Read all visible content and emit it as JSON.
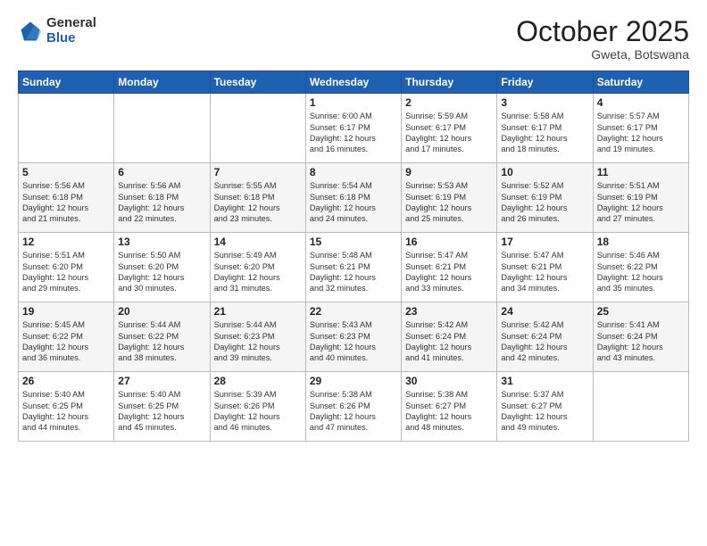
{
  "header": {
    "logo_general": "General",
    "logo_blue": "Blue",
    "month_title": "October 2025",
    "subtitle": "Gweta, Botswana"
  },
  "days_of_week": [
    "Sunday",
    "Monday",
    "Tuesday",
    "Wednesday",
    "Thursday",
    "Friday",
    "Saturday"
  ],
  "weeks": [
    [
      {
        "day": "",
        "info": ""
      },
      {
        "day": "",
        "info": ""
      },
      {
        "day": "",
        "info": ""
      },
      {
        "day": "1",
        "info": "Sunrise: 6:00 AM\nSunset: 6:17 PM\nDaylight: 12 hours\nand 16 minutes."
      },
      {
        "day": "2",
        "info": "Sunrise: 5:59 AM\nSunset: 6:17 PM\nDaylight: 12 hours\nand 17 minutes."
      },
      {
        "day": "3",
        "info": "Sunrise: 5:58 AM\nSunset: 6:17 PM\nDaylight: 12 hours\nand 18 minutes."
      },
      {
        "day": "4",
        "info": "Sunrise: 5:57 AM\nSunset: 6:17 PM\nDaylight: 12 hours\nand 19 minutes."
      }
    ],
    [
      {
        "day": "5",
        "info": "Sunrise: 5:56 AM\nSunset: 6:18 PM\nDaylight: 12 hours\nand 21 minutes."
      },
      {
        "day": "6",
        "info": "Sunrise: 5:56 AM\nSunset: 6:18 PM\nDaylight: 12 hours\nand 22 minutes."
      },
      {
        "day": "7",
        "info": "Sunrise: 5:55 AM\nSunset: 6:18 PM\nDaylight: 12 hours\nand 23 minutes."
      },
      {
        "day": "8",
        "info": "Sunrise: 5:54 AM\nSunset: 6:18 PM\nDaylight: 12 hours\nand 24 minutes."
      },
      {
        "day": "9",
        "info": "Sunrise: 5:53 AM\nSunset: 6:19 PM\nDaylight: 12 hours\nand 25 minutes."
      },
      {
        "day": "10",
        "info": "Sunrise: 5:52 AM\nSunset: 6:19 PM\nDaylight: 12 hours\nand 26 minutes."
      },
      {
        "day": "11",
        "info": "Sunrise: 5:51 AM\nSunset: 6:19 PM\nDaylight: 12 hours\nand 27 minutes."
      }
    ],
    [
      {
        "day": "12",
        "info": "Sunrise: 5:51 AM\nSunset: 6:20 PM\nDaylight: 12 hours\nand 29 minutes."
      },
      {
        "day": "13",
        "info": "Sunrise: 5:50 AM\nSunset: 6:20 PM\nDaylight: 12 hours\nand 30 minutes."
      },
      {
        "day": "14",
        "info": "Sunrise: 5:49 AM\nSunset: 6:20 PM\nDaylight: 12 hours\nand 31 minutes."
      },
      {
        "day": "15",
        "info": "Sunrise: 5:48 AM\nSunset: 6:21 PM\nDaylight: 12 hours\nand 32 minutes."
      },
      {
        "day": "16",
        "info": "Sunrise: 5:47 AM\nSunset: 6:21 PM\nDaylight: 12 hours\nand 33 minutes."
      },
      {
        "day": "17",
        "info": "Sunrise: 5:47 AM\nSunset: 6:21 PM\nDaylight: 12 hours\nand 34 minutes."
      },
      {
        "day": "18",
        "info": "Sunrise: 5:46 AM\nSunset: 6:22 PM\nDaylight: 12 hours\nand 35 minutes."
      }
    ],
    [
      {
        "day": "19",
        "info": "Sunrise: 5:45 AM\nSunset: 6:22 PM\nDaylight: 12 hours\nand 36 minutes."
      },
      {
        "day": "20",
        "info": "Sunrise: 5:44 AM\nSunset: 6:22 PM\nDaylight: 12 hours\nand 38 minutes."
      },
      {
        "day": "21",
        "info": "Sunrise: 5:44 AM\nSunset: 6:23 PM\nDaylight: 12 hours\nand 39 minutes."
      },
      {
        "day": "22",
        "info": "Sunrise: 5:43 AM\nSunset: 6:23 PM\nDaylight: 12 hours\nand 40 minutes."
      },
      {
        "day": "23",
        "info": "Sunrise: 5:42 AM\nSunset: 6:24 PM\nDaylight: 12 hours\nand 41 minutes."
      },
      {
        "day": "24",
        "info": "Sunrise: 5:42 AM\nSunset: 6:24 PM\nDaylight: 12 hours\nand 42 minutes."
      },
      {
        "day": "25",
        "info": "Sunrise: 5:41 AM\nSunset: 6:24 PM\nDaylight: 12 hours\nand 43 minutes."
      }
    ],
    [
      {
        "day": "26",
        "info": "Sunrise: 5:40 AM\nSunset: 6:25 PM\nDaylight: 12 hours\nand 44 minutes."
      },
      {
        "day": "27",
        "info": "Sunrise: 5:40 AM\nSunset: 6:25 PM\nDaylight: 12 hours\nand 45 minutes."
      },
      {
        "day": "28",
        "info": "Sunrise: 5:39 AM\nSunset: 6:26 PM\nDaylight: 12 hours\nand 46 minutes."
      },
      {
        "day": "29",
        "info": "Sunrise: 5:38 AM\nSunset: 6:26 PM\nDaylight: 12 hours\nand 47 minutes."
      },
      {
        "day": "30",
        "info": "Sunrise: 5:38 AM\nSunset: 6:27 PM\nDaylight: 12 hours\nand 48 minutes."
      },
      {
        "day": "31",
        "info": "Sunrise: 5:37 AM\nSunset: 6:27 PM\nDaylight: 12 hours\nand 49 minutes."
      },
      {
        "day": "",
        "info": ""
      }
    ]
  ]
}
